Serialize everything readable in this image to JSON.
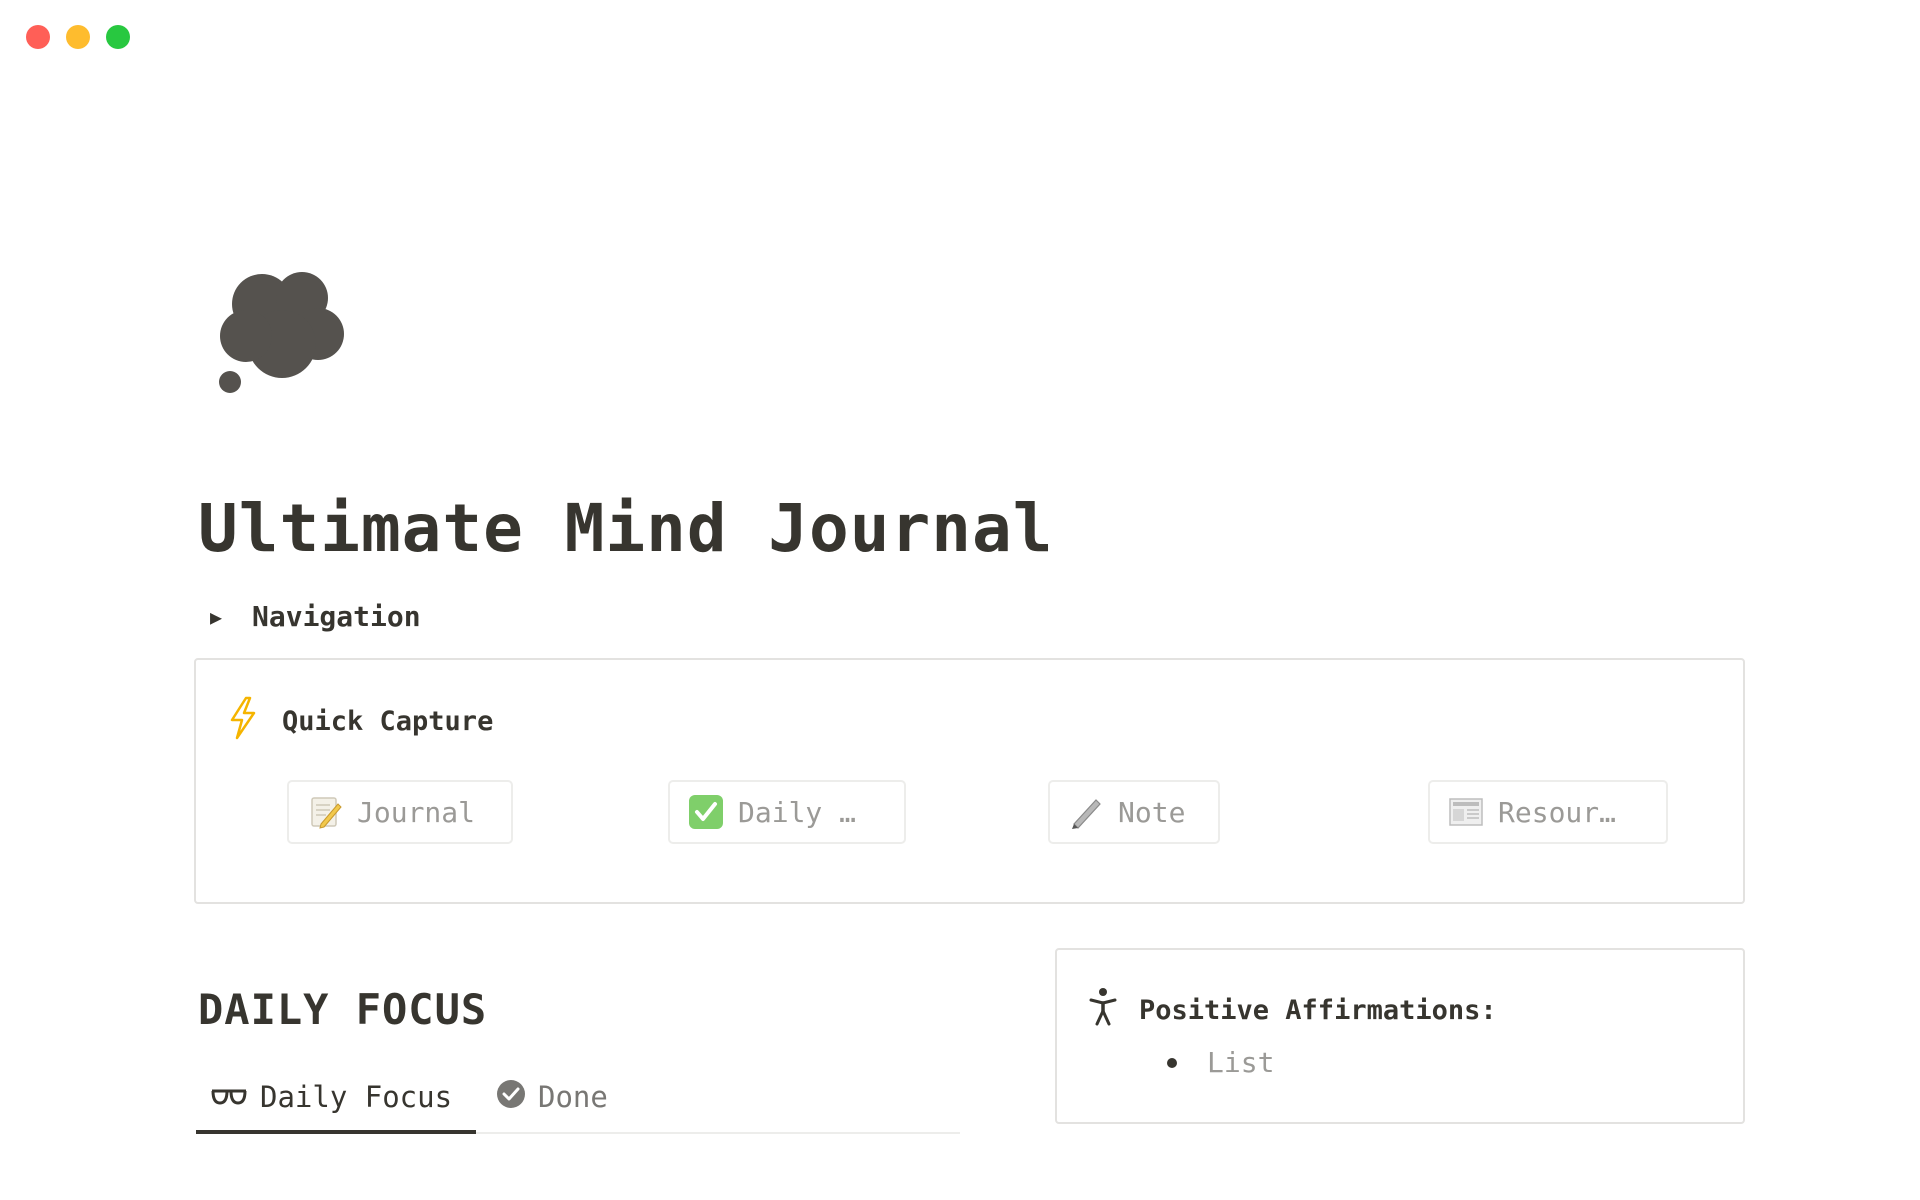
{
  "window": {
    "traffic_lights": [
      {
        "name": "close",
        "color": "#ff5f57"
      },
      {
        "name": "minimize",
        "color": "#febc2e"
      },
      {
        "name": "zoom",
        "color": "#28c840"
      }
    ]
  },
  "page": {
    "icon": "thought-balloon-icon",
    "title": "Ultimate Mind Journal"
  },
  "navigation_toggle": {
    "label": "Navigation",
    "state": "collapsed"
  },
  "quick_capture": {
    "icon": "lightning-icon",
    "heading": "Quick Capture",
    "buttons": [
      {
        "icon": "memo-icon",
        "label": "Journal"
      },
      {
        "icon": "check-mark-button-icon",
        "label": "Daily …"
      },
      {
        "icon": "pen-icon",
        "label": "Note"
      },
      {
        "icon": "newspaper-icon",
        "label": "Resour…"
      }
    ]
  },
  "daily_focus": {
    "heading": "DAILY FOCUS",
    "tabs": [
      {
        "icon": "glasses-icon",
        "label": "Daily Focus",
        "active": true
      },
      {
        "icon": "check-circle-icon",
        "label": "Done",
        "active": false
      }
    ]
  },
  "affirmations": {
    "icon": "accessibility-icon",
    "heading": "Positive Affirmations:",
    "items": [
      "List"
    ]
  },
  "colors": {
    "text": "#37352f",
    "muted": "#9b9a97",
    "border": "#e3e2e0",
    "accent_lightning": "#f5b400"
  }
}
